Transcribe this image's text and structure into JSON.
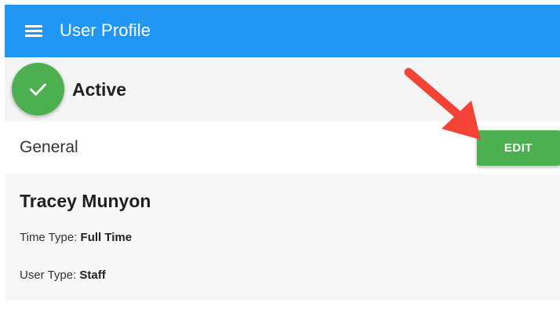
{
  "appbar": {
    "title": "User Profile",
    "menu_icon": "menu-icon",
    "color": "#2196F3"
  },
  "status": {
    "icon": "check-icon",
    "label": "Active",
    "color": "#4CAF50"
  },
  "general": {
    "label": "General",
    "edit_label": "EDIT",
    "edit_color": "#4CAF50"
  },
  "profile": {
    "name": "Tracey Munyon",
    "time_type_label": "Time Type:",
    "time_type_value": "Full Time",
    "user_type_label": "User Type:",
    "user_type_value": "Staff"
  },
  "annotation": {
    "icon": "arrow-pointer-icon",
    "color": "#F44336"
  }
}
